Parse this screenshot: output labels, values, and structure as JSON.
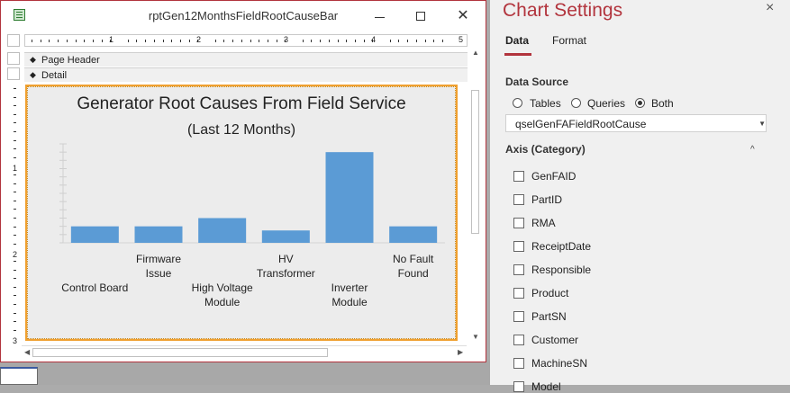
{
  "report_window": {
    "title": "rptGen12MonthsFieldRootCauseBar",
    "sections": {
      "page_header": "Page Header",
      "detail": "Detail"
    },
    "ruler_numbers": [
      "1",
      "2",
      "3",
      "4",
      "5"
    ],
    "vruler_numbers": [
      "1",
      "2",
      "3"
    ]
  },
  "chart_data": {
    "type": "bar",
    "title": "Generator Root Causes From Field Service",
    "subtitle": "(Last 12 Months)",
    "categories": [
      "Control Board",
      "Firmware Issue",
      "High Voltage Module",
      "HV Transformer",
      "Inverter Module",
      "No Fault Found"
    ],
    "category_lines": [
      [
        "Control Board"
      ],
      [
        "Firmware",
        "Issue"
      ],
      [
        "High Voltage",
        "Module"
      ],
      [
        "HV",
        "Transformer"
      ],
      [
        "Inverter",
        "Module"
      ],
      [
        "No Fault",
        "Found"
      ]
    ],
    "label_rows": [
      1,
      0,
      1,
      0,
      1,
      0
    ],
    "values": [
      2,
      2,
      3,
      1.5,
      11,
      2
    ],
    "ylim": [
      0,
      12
    ],
    "bar_color": "#5b9bd5"
  },
  "settings_pane": {
    "title": "Chart Settings",
    "close_icon": "×",
    "tabs": [
      "Data",
      "Format"
    ],
    "data_source_label": "Data Source",
    "radios": [
      {
        "label": "Tables",
        "checked": false
      },
      {
        "label": "Queries",
        "checked": false
      },
      {
        "label": "Both",
        "checked": true
      }
    ],
    "data_source_value": "qselGenFAFieldRootCause",
    "axis_label": "Axis (Category)",
    "fields": [
      "GenFAID",
      "PartID",
      "RMA",
      "ReceiptDate",
      "Responsible",
      "Product",
      "PartSN",
      "Customer",
      "MachineSN",
      "Model"
    ]
  }
}
